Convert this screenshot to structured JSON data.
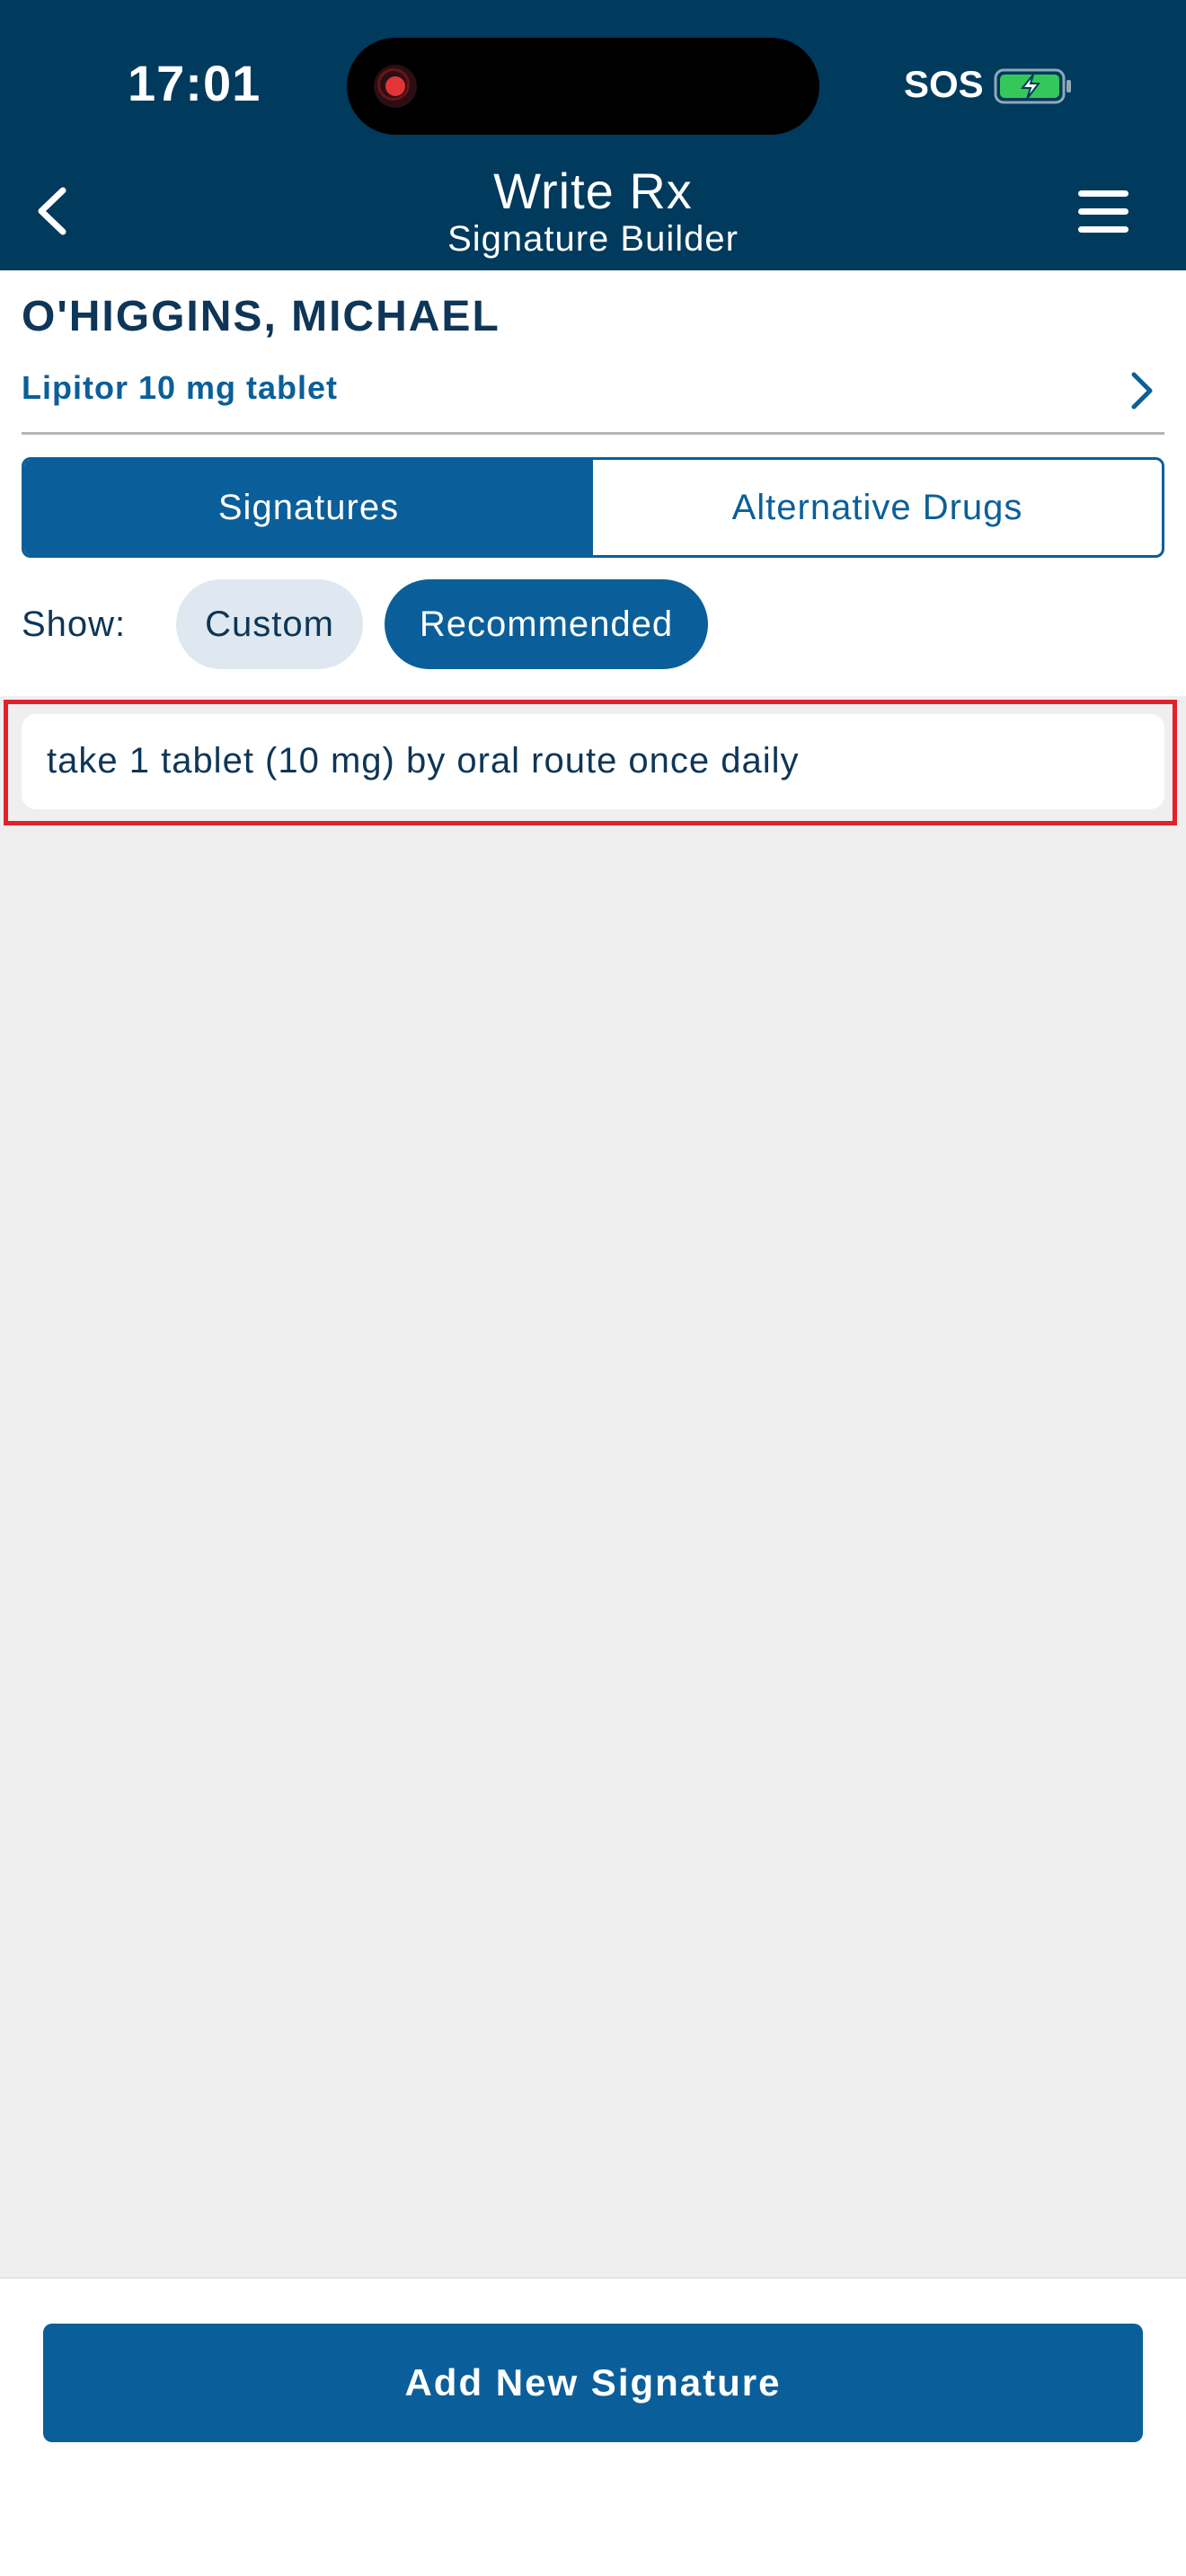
{
  "status_bar": {
    "time": "17:01",
    "network": "SOS",
    "recording_indicator": "record-icon",
    "battery_icon": "battery-charging-icon"
  },
  "header": {
    "title": "Write Rx",
    "subtitle": "Signature Builder",
    "back_icon": "chevron-left-icon",
    "menu_icon": "hamburger-menu-icon"
  },
  "patient": {
    "name": "O'HIGGINS, MICHAEL",
    "drug": "Lipitor 10 mg tablet"
  },
  "tabs": [
    {
      "label": "Signatures",
      "active": true
    },
    {
      "label": "Alternative Drugs",
      "active": false
    }
  ],
  "filter": {
    "label": "Show:",
    "options": [
      {
        "label": "Custom",
        "selected": false
      },
      {
        "label": "Recommended",
        "selected": true
      }
    ]
  },
  "signatures": [
    {
      "text": "take 1 tablet (10 mg) by oral route once daily"
    }
  ],
  "footer": {
    "add_label": "Add New Signature"
  },
  "colors": {
    "header_bg": "#003a5d",
    "primary": "#0a5f9a",
    "text_dark": "#0d3658",
    "highlight": "#e0222d",
    "battery_green": "#34c759"
  }
}
